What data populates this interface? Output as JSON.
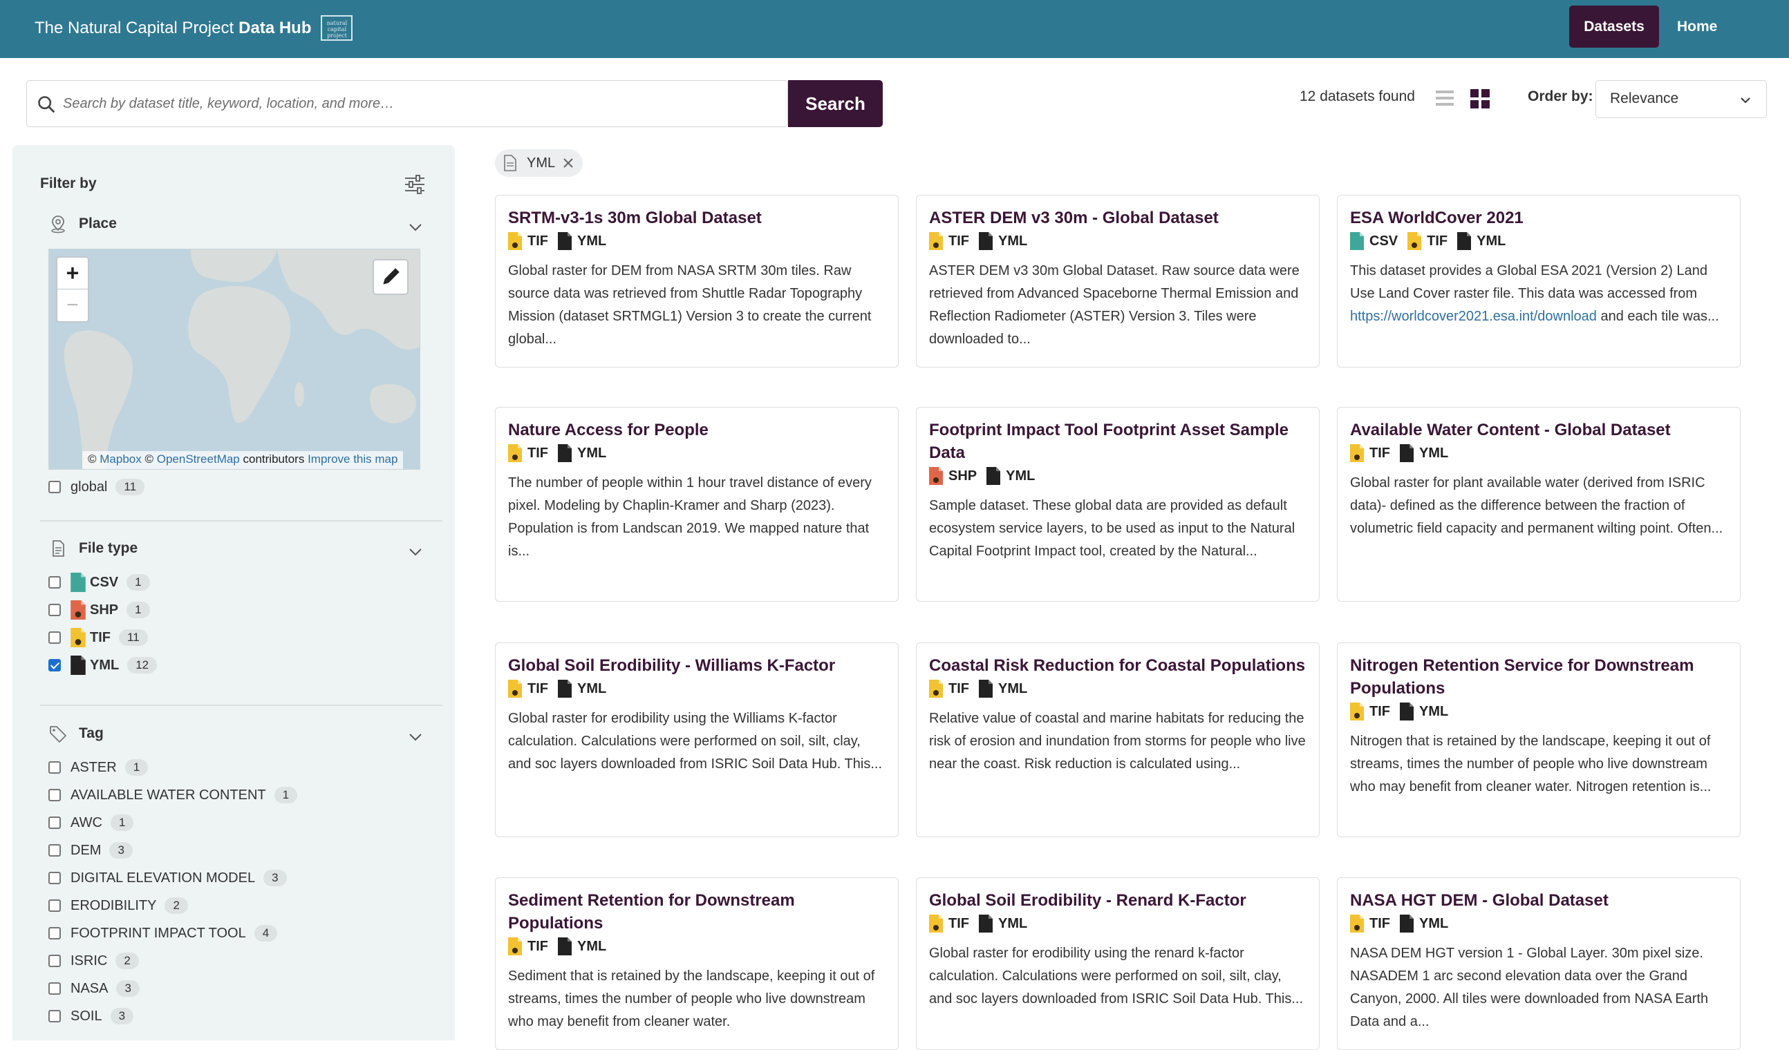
{
  "header": {
    "brand_prefix": "The Natural Capital Project",
    "brand_strong": "Data Hub",
    "logo_text": "natural capital project",
    "nav": {
      "datasets": "Datasets",
      "home": "Home"
    },
    "colors": {
      "bar": "#2f7891",
      "accent": "#3a1636"
    }
  },
  "search": {
    "placeholder": "Search by dataset title, keyword, location, and more…",
    "value": "",
    "button": "Search"
  },
  "results": {
    "found": "12 datasets found",
    "order_label": "Order by:",
    "order_value": "Relevance"
  },
  "filters": {
    "title": "Filter by",
    "place": {
      "label": "Place",
      "attribution": {
        "copy1": "©",
        "mapbox": "Mapbox",
        "copy2": "©",
        "osm": "OpenStreetMap",
        "contributors": "contributors",
        "improve": "Improve this map"
      },
      "items": [
        {
          "label": "global",
          "count": "11",
          "checked": false
        }
      ]
    },
    "file_type": {
      "label": "File type",
      "items": [
        {
          "label": "CSV",
          "count": "1",
          "checked": false,
          "icon": "csv-file-icon",
          "color": "#3fa79a"
        },
        {
          "label": "SHP",
          "count": "1",
          "checked": false,
          "icon": "shp-file-icon",
          "color": "#e0664a"
        },
        {
          "label": "TIF",
          "count": "11",
          "checked": false,
          "icon": "tif-file-icon",
          "color": "#f2c230"
        },
        {
          "label": "YML",
          "count": "12",
          "checked": true,
          "icon": "yml-file-icon",
          "color": "#222222"
        }
      ]
    },
    "tag": {
      "label": "Tag",
      "items": [
        {
          "label": "ASTER",
          "count": "1"
        },
        {
          "label": "AVAILABLE WATER CONTENT",
          "count": "1"
        },
        {
          "label": "AWC",
          "count": "1"
        },
        {
          "label": "DEM",
          "count": "3"
        },
        {
          "label": "DIGITAL ELEVATION MODEL",
          "count": "3"
        },
        {
          "label": "ERODIBILITY",
          "count": "2"
        },
        {
          "label": "FOOTPRINT IMPACT TOOL",
          "count": "4"
        },
        {
          "label": "ISRIC",
          "count": "2"
        },
        {
          "label": "NASA",
          "count": "3"
        },
        {
          "label": "SOIL",
          "count": "3"
        }
      ]
    }
  },
  "active_filter": {
    "label": "YML"
  },
  "cards": [
    {
      "title": "SRTM-v3-1s 30m Global Dataset",
      "types": [
        "TIF",
        "YML"
      ],
      "desc": "Global raster for DEM from NASA SRTM 30m tiles. Raw source data was retrieved from Shuttle Radar Topography Mission (dataset SRTMGL1) Version 3 to create the current global..."
    },
    {
      "title": "ASTER DEM v3 30m - Global Dataset",
      "types": [
        "TIF",
        "YML"
      ],
      "desc": "ASTER DEM v3 30m Global Dataset. Raw source data were retrieved from Advanced Spaceborne Thermal Emission and Reflection Radiometer (ASTER) Version 3. Tiles were downloaded to..."
    },
    {
      "title": "ESA WorldCover 2021",
      "types": [
        "CSV",
        "TIF",
        "YML"
      ],
      "desc_pre": "This dataset provides a Global ESA 2021 (Version 2) Land Use Land Cover raster file. This data was accessed from ",
      "link": "https://worldcover2021.esa.int/download",
      "desc_post": " and each tile was..."
    },
    {
      "title": "Nature Access for People",
      "types": [
        "TIF",
        "YML"
      ],
      "desc": "The number of people within 1 hour travel distance of every pixel. Modeling by Chaplin-Kramer and Sharp (2023). Population is from Landscan 2019. We mapped nature that is..."
    },
    {
      "title": "Footprint Impact Tool Footprint Asset Sample Data",
      "types": [
        "SHP",
        "YML"
      ],
      "desc": "Sample dataset. These global data are provided as default ecosystem service layers, to be used as input to the Natural Capital Footprint Impact tool, created by the Natural..."
    },
    {
      "title": "Available Water Content - Global Dataset",
      "types": [
        "TIF",
        "YML"
      ],
      "desc": "Global raster for plant available water (derived from ISRIC data)- defined as the difference between the fraction of volumetric field capacity and permanent wilting point. Often..."
    },
    {
      "title": "Global Soil Erodibility - Williams K-Factor",
      "types": [
        "TIF",
        "YML"
      ],
      "desc": "Global raster for erodibility using the Williams K-factor calculation. Calculations were performed on soil, silt, clay, and soc layers downloaded from ISRIC Soil Data Hub. This..."
    },
    {
      "title": "Coastal Risk Reduction for Coastal Populations",
      "types": [
        "TIF",
        "YML"
      ],
      "desc": "Relative value of coastal and marine habitats for reducing the risk of erosion and inundation from storms for people who live near the coast. Risk reduction is calculated using..."
    },
    {
      "title": "Nitrogen Retention Service for Downstream Populations",
      "types": [
        "TIF",
        "YML"
      ],
      "desc": "Nitrogen that is retained by the landscape, keeping it out of streams, times the number of people who live downstream who may benefit from cleaner water. Nitrogen retention is..."
    },
    {
      "title": "Sediment Retention for Downstream Populations",
      "types": [
        "TIF",
        "YML"
      ],
      "desc": "Sediment that is retained by the landscape, keeping it out of streams, times the number of people who live downstream who may benefit from cleaner water."
    },
    {
      "title": "Global Soil Erodibility - Renard K-Factor",
      "types": [
        "TIF",
        "YML"
      ],
      "desc": "Global raster for erodibility using the renard k-factor calculation. Calculations were performed on soil, silt, clay, and soc layers downloaded from ISRIC Soil Data Hub. This..."
    },
    {
      "title": "NASA HGT DEM - Global Dataset",
      "types": [
        "TIF",
        "YML"
      ],
      "desc": "NASA DEM HGT version 1 - Global Layer. 30m pixel size. NASADEM 1 arc second elevation data over the Grand Canyon, 2000. All tiles were downloaded from NASA Earth Data and a..."
    }
  ]
}
